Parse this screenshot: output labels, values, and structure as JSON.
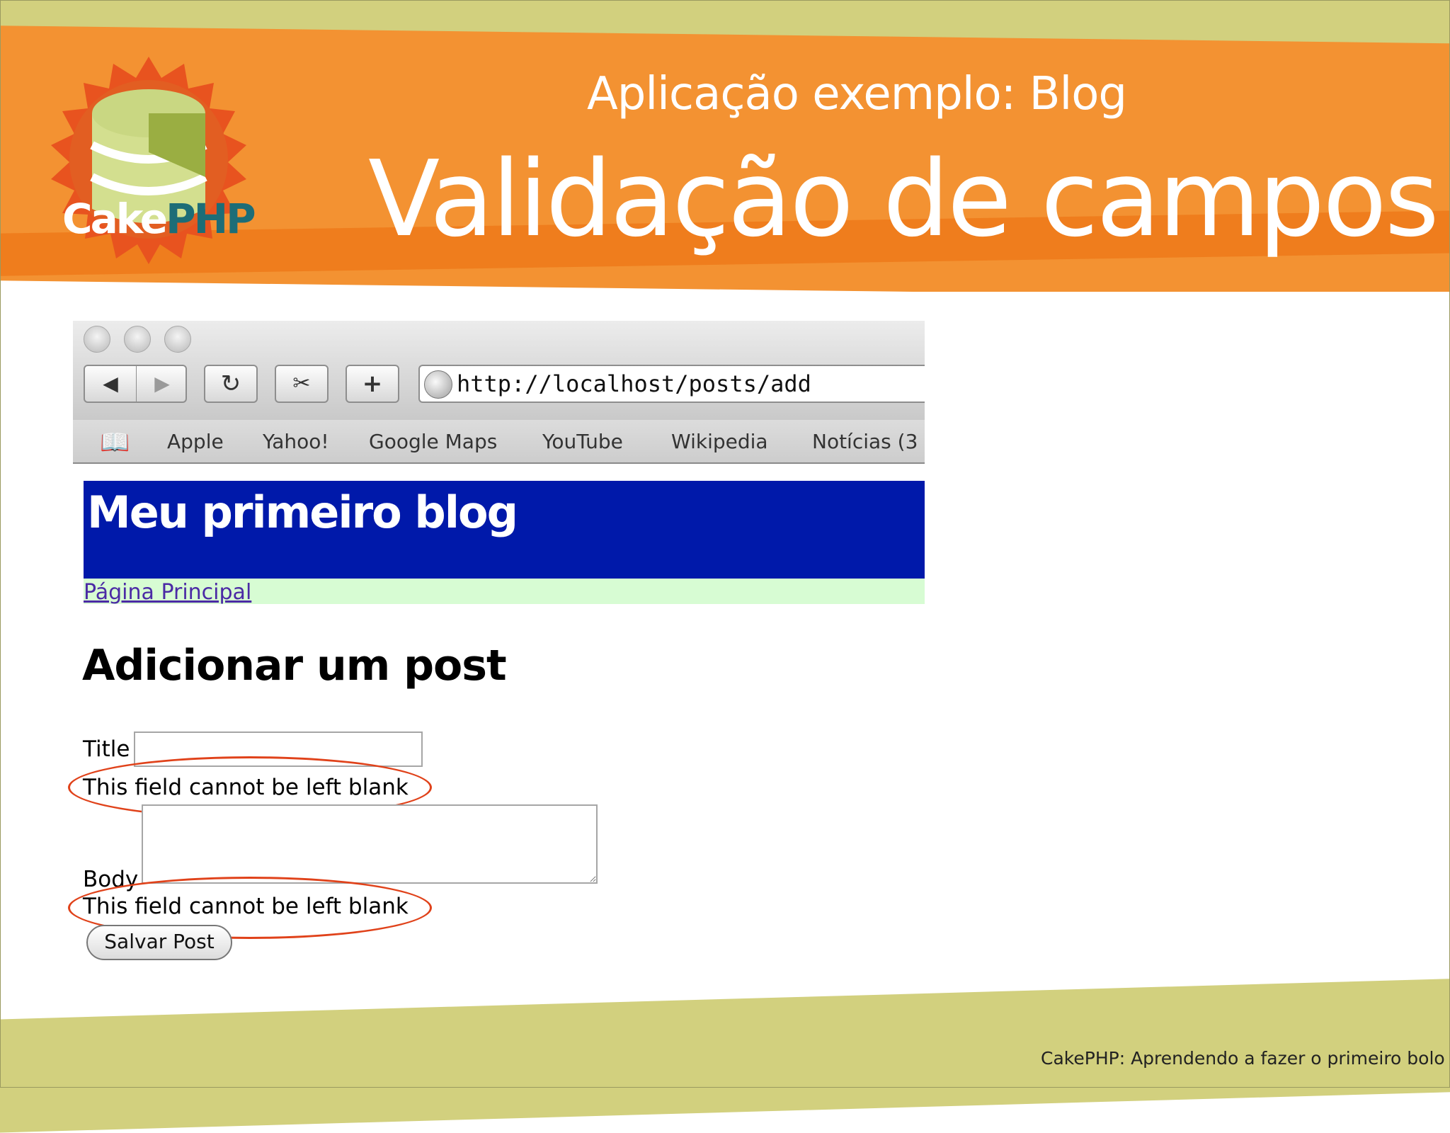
{
  "slide": {
    "subtitle": "Aplicação exemplo: Blog",
    "title": "Validação de campos",
    "footer": "CakePHP: Aprendendo a fazer o primeiro bolo",
    "colors": {
      "banner": "#f39232",
      "band": "#d2d07e",
      "blog_header": "#0019aa",
      "nav_strip": "#d7fcd3",
      "highlight_circle": "#e0421a"
    }
  },
  "logo": {
    "word_cake": "Cake",
    "word_php": "PHP"
  },
  "browser": {
    "url": "http://localhost/posts/add",
    "toolbar": {
      "back_icon": "◀",
      "forward_icon": "▶",
      "reload_icon": "↻",
      "snip_icon": "✂",
      "add_icon": "+"
    },
    "bookmarks_icon": "📖",
    "bookmarks": [
      "Apple",
      "Yahoo!",
      "Google Maps",
      "YouTube",
      "Wikipedia",
      "Notícias (3"
    ]
  },
  "blog": {
    "title": "Meu primeiro blog",
    "home_link": "Página Principal"
  },
  "form": {
    "heading": "Adicionar um post",
    "title_label": "Title",
    "title_value": "",
    "title_error": "This field cannot be left blank",
    "body_label": "Body",
    "body_value": "",
    "body_error": "This field cannot be left blank",
    "submit_label": "Salvar Post"
  }
}
